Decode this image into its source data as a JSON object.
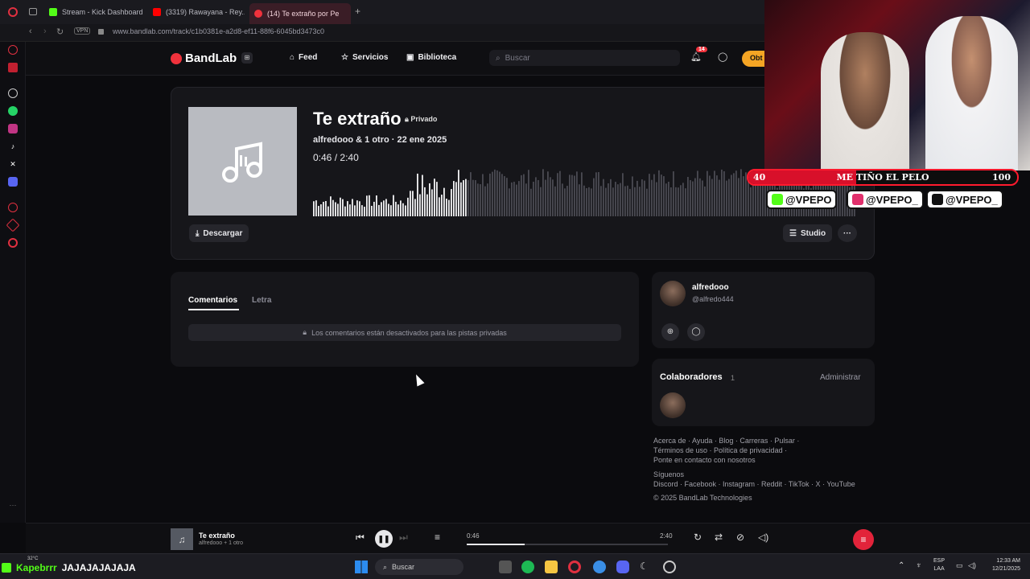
{
  "browser": {
    "tabs": [
      {
        "label": "Stream - Kick Dashboard",
        "color": "#53fc18"
      },
      {
        "label": "(3319) Rawayana - Rey...",
        "color": "#ff0000"
      },
      {
        "label": "(14) Te extraño por Pe",
        "color": "#f0323c"
      }
    ],
    "vpn_label": "VPN",
    "url": "www.bandlab.com/track/c1b0381e-a2d8-ef11-88f6-6045bd3473c0"
  },
  "header": {
    "brand": "BandLab",
    "nav": [
      {
        "label": "Feed",
        "icon": "home-icon"
      },
      {
        "label": "Servicios",
        "icon": "star-icon"
      },
      {
        "label": "Biblioteca",
        "icon": "library-icon"
      }
    ],
    "search_placeholder": "Buscar",
    "notification_count": "14",
    "upgrade_label": "Obt"
  },
  "track": {
    "title": "Te extraño",
    "privacy": "Privado",
    "artist_line": "alfredooo & 1 otro · 22 ene 2025",
    "current_time": "0:46",
    "separator": "/",
    "duration": "2:40",
    "progress": 0.2875,
    "download_label": "Descargar",
    "studio_label": "Studio",
    "more_label": "···"
  },
  "comments": {
    "tabs": [
      "Comentarios",
      "Letra"
    ],
    "disabled_message": "Los comentarios están desactivados para las pistas privadas"
  },
  "owner": {
    "name": "alfredooo",
    "handle": "@alfredo444"
  },
  "collaborators": {
    "title": "Colaboradores",
    "count": "1",
    "manage_label": "Administrar"
  },
  "footer": {
    "line1": "Acerca de · Ayuda · Blog · Carreras · Pulsar ·",
    "line2": "Términos de uso · Política de privacidad ·",
    "line3": "Ponte en contacto con nosotros",
    "follow_label": "Síguenos",
    "socials": "Discord · Facebook · Instagram · Reddit · TikTok · X · YouTube",
    "copyright": "© 2025 BandLab Technologies"
  },
  "player": {
    "title": "Te extraño",
    "artist": "alfredooo + 1 otro",
    "current_time": "0:46",
    "duration": "2:40",
    "progress": 0.2875
  },
  "taskbar": {
    "stream_user": "Kapebrrr",
    "chat_text": "JAJAJAJAJAJA",
    "weather": "32°C",
    "search_label": "Buscar",
    "lang": "ESP",
    "region": "LAA",
    "time": "12:33 AM",
    "date": "12/21/2025"
  },
  "webcam": {
    "goal_current": "40",
    "goal_label": "ME TIÑO EL PELO",
    "goal_max": "100",
    "goal_fraction": 0.4,
    "social_handles": [
      "@VPEPO",
      "@VPEPO_",
      "@VPEPO_"
    ]
  },
  "colors": {
    "brand_red": "#f0323c",
    "card_bg": "#16161a",
    "accent_orange": "#f5a524"
  }
}
